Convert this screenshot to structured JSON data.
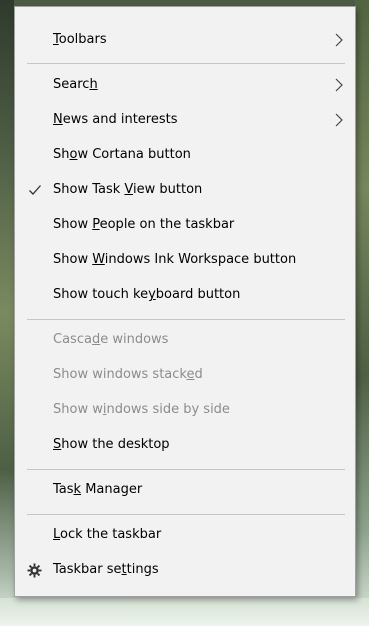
{
  "menu": {
    "items": [
      {
        "label": "Toolbars",
        "accesskey": "T",
        "submenu": true
      },
      {
        "label": "Search",
        "accesskey": "h",
        "submenu": true
      },
      {
        "label": "News and interests",
        "accesskey": "N",
        "submenu": true
      },
      {
        "label": "Show Cortana button",
        "accesskey": "o"
      },
      {
        "label": "Show Task View button",
        "accesskey": "V",
        "checked": true
      },
      {
        "label": "Show People on the taskbar",
        "accesskey": "P"
      },
      {
        "label": "Show Windows Ink Workspace button",
        "accesskey": "W"
      },
      {
        "label": "Show touch keyboard button",
        "accesskey": "y"
      },
      {
        "label": "Cascade windows",
        "accesskey": "d",
        "disabled": true
      },
      {
        "label": "Show windows stacked",
        "accesskey": "e",
        "disabled": true
      },
      {
        "label": "Show windows side by side",
        "accesskey": "i",
        "disabled": true
      },
      {
        "label": "Show the desktop",
        "accesskey": "S"
      },
      {
        "label": "Task Manager",
        "accesskey": "k"
      },
      {
        "label": "Lock the taskbar",
        "accesskey": "L"
      },
      {
        "label": "Taskbar settings",
        "accesskey": "t",
        "icon": "gear-icon"
      }
    ]
  },
  "icons": {
    "submenu_arrow": "chevron-right-icon",
    "check": "checkmark-icon",
    "settings": "gear-icon"
  },
  "colors": {
    "menu_background": "#f2f2f2",
    "menu_border": "#a0a0a0",
    "separator": "#c6c6c6",
    "text": "#000000",
    "disabled_text": "#8c8c8c"
  }
}
